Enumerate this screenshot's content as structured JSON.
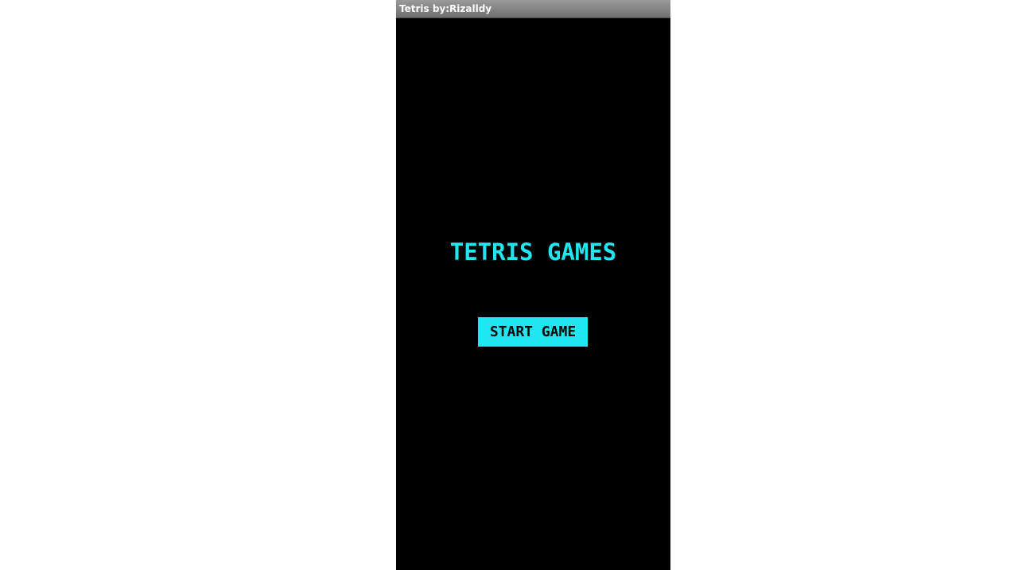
{
  "window": {
    "title": "Tetris by:Rizalldy"
  },
  "main": {
    "game_title": "TETRIS GAMES",
    "start_button_label": "START GAME"
  },
  "colors": {
    "accent": "#1fe6f0",
    "background": "#000000",
    "title_bar": "#808080"
  }
}
